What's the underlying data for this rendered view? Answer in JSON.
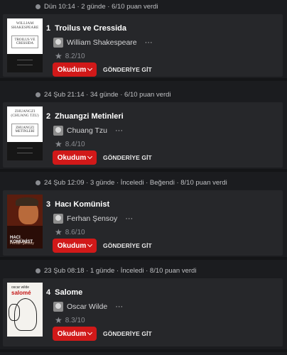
{
  "entries": [
    {
      "meta": "Dün 10:14 · 2 günde · 6/10 puan verdi",
      "number": "1",
      "title": "Troilus ve Cressida",
      "author": "William Shakespeare",
      "rating": "8.2/10",
      "read_label": "Okudum",
      "go_label": "GÖNDERİYE GİT",
      "cover": {
        "style": "classic",
        "line1": "WILLIAM SHAKESPEARE",
        "line2": "TROILUS VE CRESSIDA"
      }
    },
    {
      "meta": "24 Şub 21:14 · 34 günde · 6/10 puan verdi",
      "number": "2",
      "title": "Zhuangzi Metinleri",
      "author": "Chuang Tzu",
      "rating": "8.4/10",
      "read_label": "Okudum",
      "go_label": "GÖNDERİYE GİT",
      "cover": {
        "style": "classic",
        "line1": "ZHUANGZI (CHUANG TZU)",
        "line2": "ZHUANGZI METİNLERİ"
      }
    },
    {
      "meta": "24 Şub 12:09 · 3 günde · İnceledi · Beğendi · 8/10 puan verdi",
      "number": "3",
      "title": "Hacı Komünist",
      "author": "Ferhan Şensoy",
      "rating": "8.6/10",
      "read_label": "Okudum",
      "go_label": "GÖNDERİYE GİT",
      "cover": {
        "style": "photo",
        "line1": "HACI KOMÜNİST",
        "line2": "Ferhan Şensoy"
      }
    },
    {
      "meta": "23 Şub 08:18 · 1 günde · İnceledi · 8/10 puan verdi",
      "number": "4",
      "title": "Salome",
      "author": "Oscar Wilde",
      "rating": "8.3/10",
      "read_label": "Okudum",
      "go_label": "GÖNDERİYE GİT",
      "cover": {
        "style": "art",
        "line1": "oscar wilde",
        "line2": "salomé"
      }
    }
  ],
  "icons": {
    "meta": "info-dot-icon",
    "rating": "star-icon",
    "menu": "more-dots-icon",
    "dropdown": "chevron-down-icon"
  },
  "colors": {
    "accent": "#d11919",
    "background": "#1b1c1f",
    "card": "#26272a"
  }
}
